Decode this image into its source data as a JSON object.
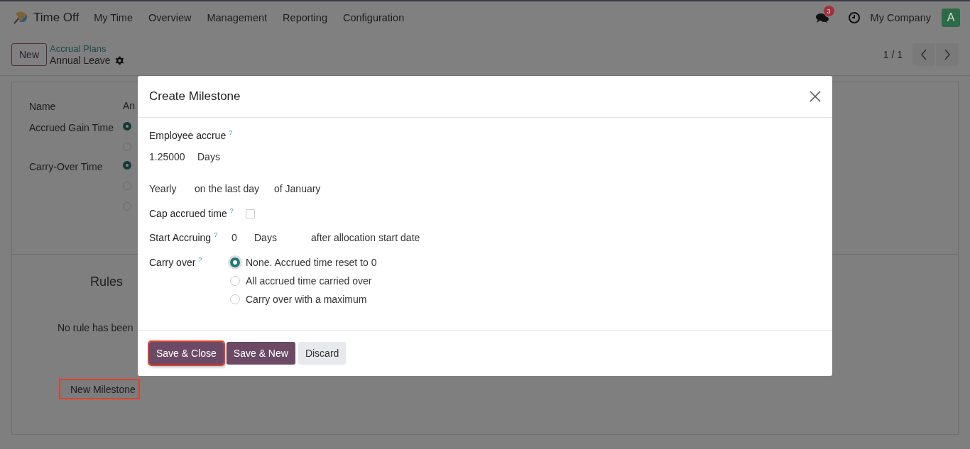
{
  "navbar": {
    "app_name": "Time Off",
    "menu": [
      "My Time",
      "Overview",
      "Management",
      "Reporting",
      "Configuration"
    ],
    "messages_badge": "3",
    "company": "My Company",
    "avatar_letter": "A"
  },
  "control_panel": {
    "new_button": "New",
    "breadcrumb": "Accrual Plans",
    "record_title": "Annual Leave",
    "pager": "1 / 1"
  },
  "form": {
    "fields": [
      {
        "label": "Name",
        "value": "An"
      },
      {
        "label": "Accrued Gain Time",
        "options": [
          {
            "selected": true
          },
          {
            "selected": false
          }
        ]
      },
      {
        "label": "Carry-Over Time",
        "options": [
          {
            "selected": true
          },
          {
            "selected": false
          },
          {
            "selected": false
          }
        ]
      }
    ],
    "rules_title": "Rules",
    "empty_text": "No rule has been",
    "new_milestone_button": "New Milestone"
  },
  "dialog": {
    "title": "Create Milestone",
    "employee_accrue": {
      "label": "Employee accrue",
      "help": "?",
      "amount": "1.25000",
      "unit": "Days"
    },
    "frequency": {
      "period": "Yearly",
      "day": "on the last day",
      "month": "of January"
    },
    "cap": {
      "label": "Cap accrued time",
      "help": "?",
      "checked": false
    },
    "start": {
      "label": "Start Accruing",
      "help": "?",
      "count": "0",
      "unit": "Days",
      "suffix": "after allocation start date"
    },
    "carry_over": {
      "label": "Carry over",
      "help": "?",
      "options": [
        {
          "label": "None. Accrued time reset to 0",
          "selected": true
        },
        {
          "label": "All accrued time carried over",
          "selected": false
        },
        {
          "label": "Carry over with a maximum",
          "selected": false
        }
      ]
    },
    "buttons": [
      {
        "label": "Save & Close",
        "kind": "primary",
        "highlighted": true
      },
      {
        "label": "Save & New",
        "kind": "primary",
        "highlighted": false
      },
      {
        "label": "Discard",
        "kind": "secondary",
        "highlighted": false
      }
    ]
  }
}
